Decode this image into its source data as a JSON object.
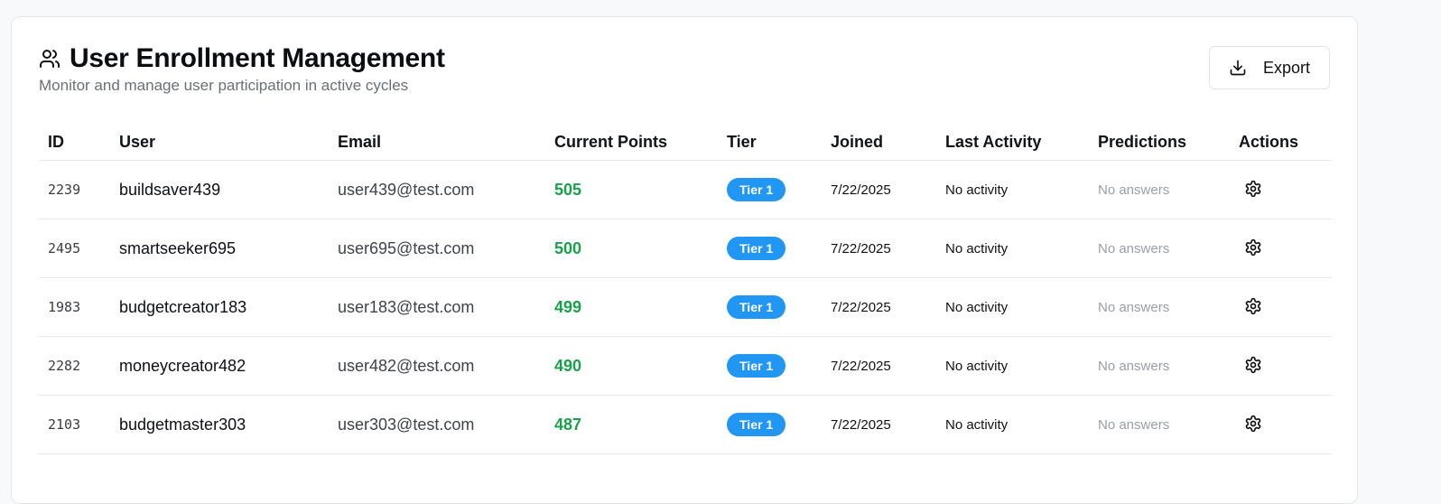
{
  "header": {
    "title": "User Enrollment Management",
    "subtitle": "Monitor and manage user participation in active cycles",
    "title_icon": "users-icon",
    "export_label": "Export",
    "export_icon": "download-icon"
  },
  "table": {
    "columns": [
      "ID",
      "User",
      "Email",
      "Current Points",
      "Tier",
      "Joined",
      "Last Activity",
      "Predictions",
      "Actions"
    ],
    "rows": [
      {
        "id": "2239",
        "user": "buildsaver439",
        "email": "user439@test.com",
        "points": "505",
        "tier": "Tier 1",
        "joined": "7/22/2025",
        "last_activity": "No activity",
        "predictions": "No answers",
        "action_icon": "gear-icon"
      },
      {
        "id": "2495",
        "user": "smartseeker695",
        "email": "user695@test.com",
        "points": "500",
        "tier": "Tier 1",
        "joined": "7/22/2025",
        "last_activity": "No activity",
        "predictions": "No answers",
        "action_icon": "gear-icon"
      },
      {
        "id": "1983",
        "user": "budgetcreator183",
        "email": "user183@test.com",
        "points": "499",
        "tier": "Tier 1",
        "joined": "7/22/2025",
        "last_activity": "No activity",
        "predictions": "No answers",
        "action_icon": "gear-icon"
      },
      {
        "id": "2282",
        "user": "moneycreator482",
        "email": "user482@test.com",
        "points": "490",
        "tier": "Tier 1",
        "joined": "7/22/2025",
        "last_activity": "No activity",
        "predictions": "No answers",
        "action_icon": "gear-icon"
      },
      {
        "id": "2103",
        "user": "budgetmaster303",
        "email": "user303@test.com",
        "points": "487",
        "tier": "Tier 1",
        "joined": "7/22/2025",
        "last_activity": "No activity",
        "predictions": "No answers",
        "action_icon": "gear-icon"
      }
    ]
  },
  "colors": {
    "points": "#17a24a",
    "tier_badge": "#2196f3",
    "muted_text": "#9a9ea6"
  }
}
